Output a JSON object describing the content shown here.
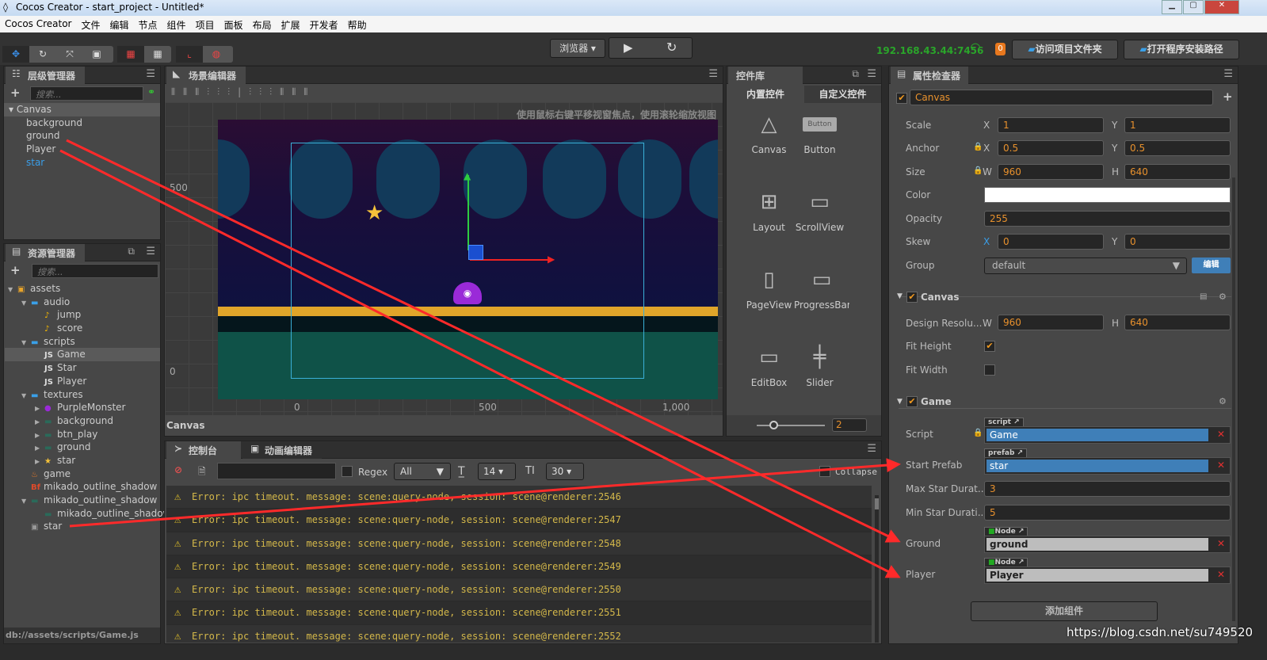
{
  "window": {
    "title": "Cocos Creator - start_project - Untitled*"
  },
  "menu": [
    "Cocos Creator",
    "文件",
    "编辑",
    "节点",
    "组件",
    "项目",
    "面板",
    "布局",
    "扩展",
    "开发者",
    "帮助"
  ],
  "toolbar": {
    "preview_select": "浏览器",
    "ip": "192.168.43.44:7456",
    "badge": "0",
    "open_project_folder": "访问项目文件夹",
    "open_install_path": "打开程序安装路径"
  },
  "hierarchy": {
    "title": "层级管理器",
    "search_placeholder": "搜索...",
    "root": "Canvas",
    "children": [
      "background",
      "ground",
      "Player",
      "star"
    ]
  },
  "assets": {
    "title": "资源管理器",
    "search_placeholder": "搜索...",
    "footer": "db://assets/scripts/Game.js",
    "items": [
      {
        "label": "assets",
        "depth": 0,
        "icon": "assets-icon",
        "arrow": "▼"
      },
      {
        "label": "audio",
        "depth": 1,
        "icon": "folder-icon",
        "arrow": "▼"
      },
      {
        "label": "jump",
        "depth": 2,
        "icon": "audio-icon",
        "arrow": ""
      },
      {
        "label": "score",
        "depth": 2,
        "icon": "audio-icon",
        "arrow": ""
      },
      {
        "label": "scripts",
        "depth": 1,
        "icon": "folder-icon",
        "arrow": "▼"
      },
      {
        "label": "Game",
        "depth": 2,
        "icon": "js-icon",
        "arrow": "",
        "selected": true
      },
      {
        "label": "Star",
        "depth": 2,
        "icon": "js-icon",
        "arrow": ""
      },
      {
        "label": "Player",
        "depth": 2,
        "icon": "js-icon",
        "arrow": ""
      },
      {
        "label": "textures",
        "depth": 1,
        "icon": "folder-icon",
        "arrow": "▼"
      },
      {
        "label": "PurpleMonster",
        "depth": 2,
        "icon": "monster-icon",
        "arrow": "▶"
      },
      {
        "label": "background",
        "depth": 2,
        "icon": "texture-icon",
        "arrow": "▶"
      },
      {
        "label": "btn_play",
        "depth": 2,
        "icon": "texture-icon",
        "arrow": "▶"
      },
      {
        "label": "ground",
        "depth": 2,
        "icon": "texture-icon",
        "arrow": "▶"
      },
      {
        "label": "star",
        "depth": 2,
        "icon": "star-icon",
        "arrow": "▶"
      },
      {
        "label": "game",
        "depth": 1,
        "icon": "scene-icon",
        "arrow": ""
      },
      {
        "label": "mikado_outline_shadow",
        "depth": 1,
        "icon": "bitmap-font-icon",
        "arrow": ""
      },
      {
        "label": "mikado_outline_shadow",
        "depth": 1,
        "icon": "texture-icon",
        "arrow": "▼"
      },
      {
        "label": "mikado_outline_shadow",
        "depth": 2,
        "icon": "texture-icon",
        "arrow": ""
      },
      {
        "label": "star",
        "depth": 1,
        "icon": "prefab-icon",
        "arrow": ""
      }
    ]
  },
  "scene": {
    "title": "场景编辑器",
    "hint": "使用鼠标右键平移视窗焦点，使用滚轮缩放视图",
    "footer": "Canvas",
    "y_ticks": [
      "500",
      "0"
    ],
    "x_ticks": [
      "0",
      "500",
      "1,000"
    ]
  },
  "widgets": {
    "title": "控件库",
    "tab_builtin": "内置控件",
    "tab_custom": "自定义控件",
    "items": [
      "Canvas",
      "Button",
      "Layout",
      "ScrollView",
      "PageView",
      "ProgressBar",
      "EditBox",
      "Slider"
    ],
    "button_preview": "Button",
    "zoom": "2"
  },
  "console": {
    "tab_console": "控制台",
    "tab_animation": "动画编辑器",
    "regex": "Regex",
    "filter": "All",
    "font_size": "14",
    "line_height": "30",
    "collapse": "Collapse",
    "lines": [
      "Error: ipc timeout. message: scene:query-node, session: scene@renderer:2546",
      "Error: ipc timeout. message: scene:query-node, session: scene@renderer:2547",
      "Error: ipc timeout. message: scene:query-node, session: scene@renderer:2548",
      "Error: ipc timeout. message: scene:query-node, session: scene@renderer:2549",
      "Error: ipc timeout. message: scene:query-node, session: scene@renderer:2550",
      "Error: ipc timeout. message: scene:query-node, session: scene@renderer:2551",
      "Error: ipc timeout. message: scene:query-node, session: scene@renderer:2552"
    ]
  },
  "inspector": {
    "title": "属性检查器",
    "node_name": "Canvas",
    "scale": {
      "label": "Scale",
      "x": "1",
      "y": "1"
    },
    "anchor": {
      "label": "Anchor",
      "x": "0.5",
      "y": "0.5"
    },
    "size": {
      "label": "Size",
      "w": "960",
      "h": "640"
    },
    "color": {
      "label": "Color",
      "value": "#ffffff"
    },
    "opacity": {
      "label": "Opacity",
      "value": "255"
    },
    "skew": {
      "label": "Skew",
      "x": "0",
      "y": "0"
    },
    "group": {
      "label": "Group",
      "value": "default",
      "edit": "编辑"
    },
    "canvas": {
      "title": "Canvas",
      "design_label": "Design Resolu...",
      "w": "960",
      "h": "640",
      "fit_height": "Fit Height",
      "fit_width": "Fit Width",
      "fit_height_checked": true,
      "fit_width_checked": false
    },
    "game": {
      "title": "Game",
      "script_label": "Script",
      "script_tag": "script",
      "script": "Game",
      "start_prefab_label": "Start Prefab",
      "prefab_tag": "prefab",
      "start_prefab": "star",
      "max_label": "Max Star Durat...",
      "max": "3",
      "min_label": "Min Star Durati...",
      "min": "5",
      "ground_label": "Ground",
      "node_tag": "Node",
      "ground": "ground",
      "player_label": "Player",
      "player": "Player"
    },
    "add_component": "添加组件"
  },
  "watermark": "https://blog.csdn.net/su749520",
  "colors": {
    "accent": "#e8912d",
    "selected_blue": "#3f7fb8",
    "ip_green": "#2aa52a",
    "annotation_red": "#ff2a2a"
  }
}
